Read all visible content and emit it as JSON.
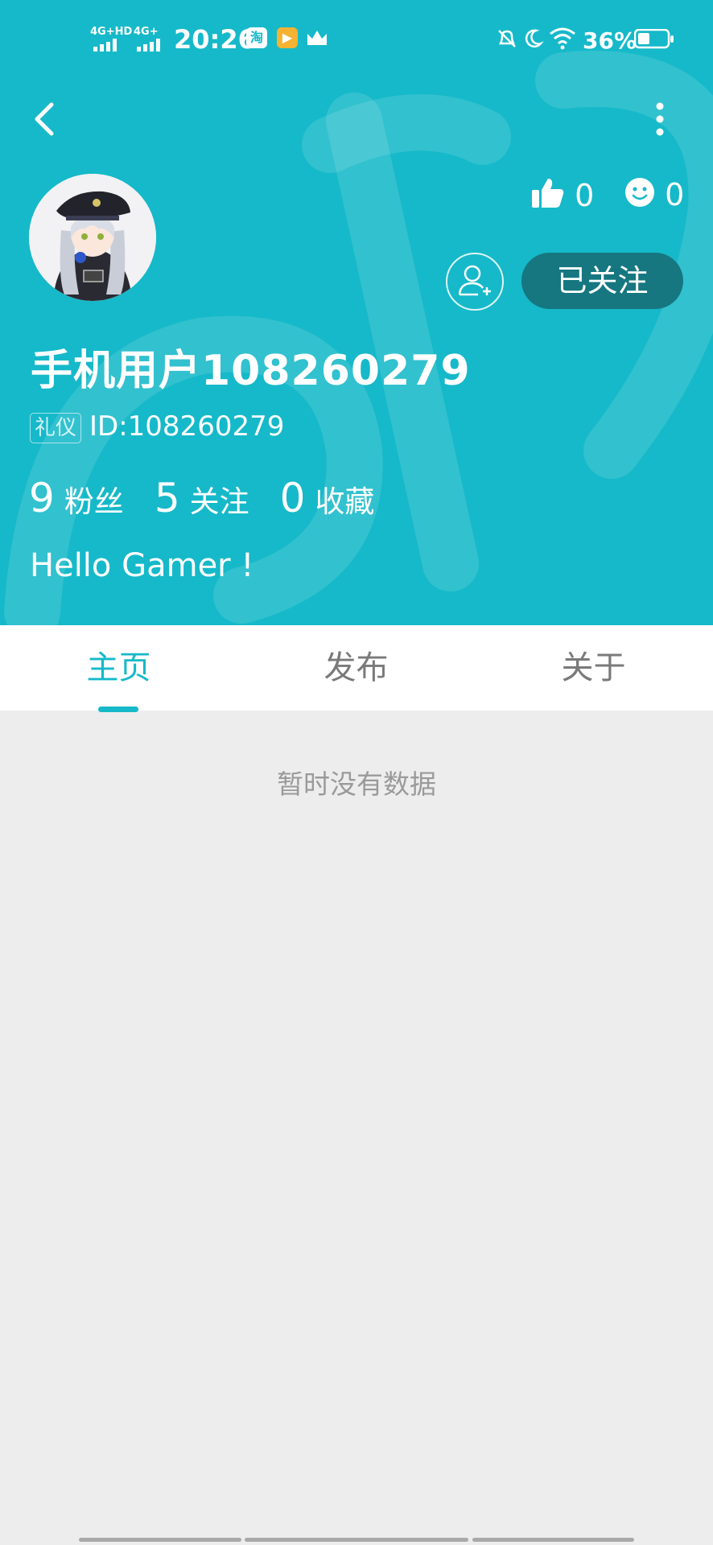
{
  "status_bar": {
    "net1": "4G+HD",
    "net2": "4G+",
    "time": "20:26",
    "app_icon_1": "淘",
    "battery": "36%"
  },
  "header": {
    "likes": "0",
    "smiles": "0",
    "follow_label": "已关注",
    "username": "手机用户108260279",
    "badge": "礼仪",
    "user_id": "ID:108260279",
    "fans_count": "9",
    "fans_label": "粉丝",
    "following_count": "5",
    "following_label": "关注",
    "favorites_count": "0",
    "favorites_label": "收藏",
    "bio": "Hello Gamer !"
  },
  "tabs": [
    {
      "label": "主页"
    },
    {
      "label": "发布"
    },
    {
      "label": "关于"
    }
  ],
  "empty_message": "暂时没有数据",
  "colors": {
    "accent": "#16b9c9",
    "follow_button": "#167780",
    "background": "#ededed"
  },
  "icons": [
    "back-arrow-icon",
    "more-vertical-icon",
    "thumbs-up-icon",
    "smile-icon",
    "add-friend-icon"
  ]
}
